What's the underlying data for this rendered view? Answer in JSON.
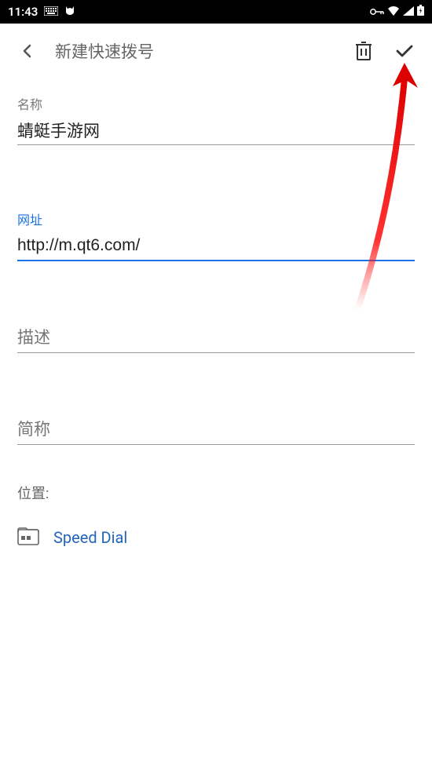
{
  "statusBar": {
    "time": "11:43",
    "keyboardIcon": "keyboard",
    "catIcon": "cat"
  },
  "header": {
    "title": "新建快速拨号"
  },
  "fields": {
    "name": {
      "label": "名称",
      "value": "蜻蜓手游网"
    },
    "url": {
      "label": "网址",
      "value": "http://m.qt6.com/"
    },
    "description": {
      "label": "描述",
      "value": ""
    },
    "shortName": {
      "label": "简称",
      "value": ""
    }
  },
  "position": {
    "label": "位置:",
    "folder": "Speed Dial"
  }
}
